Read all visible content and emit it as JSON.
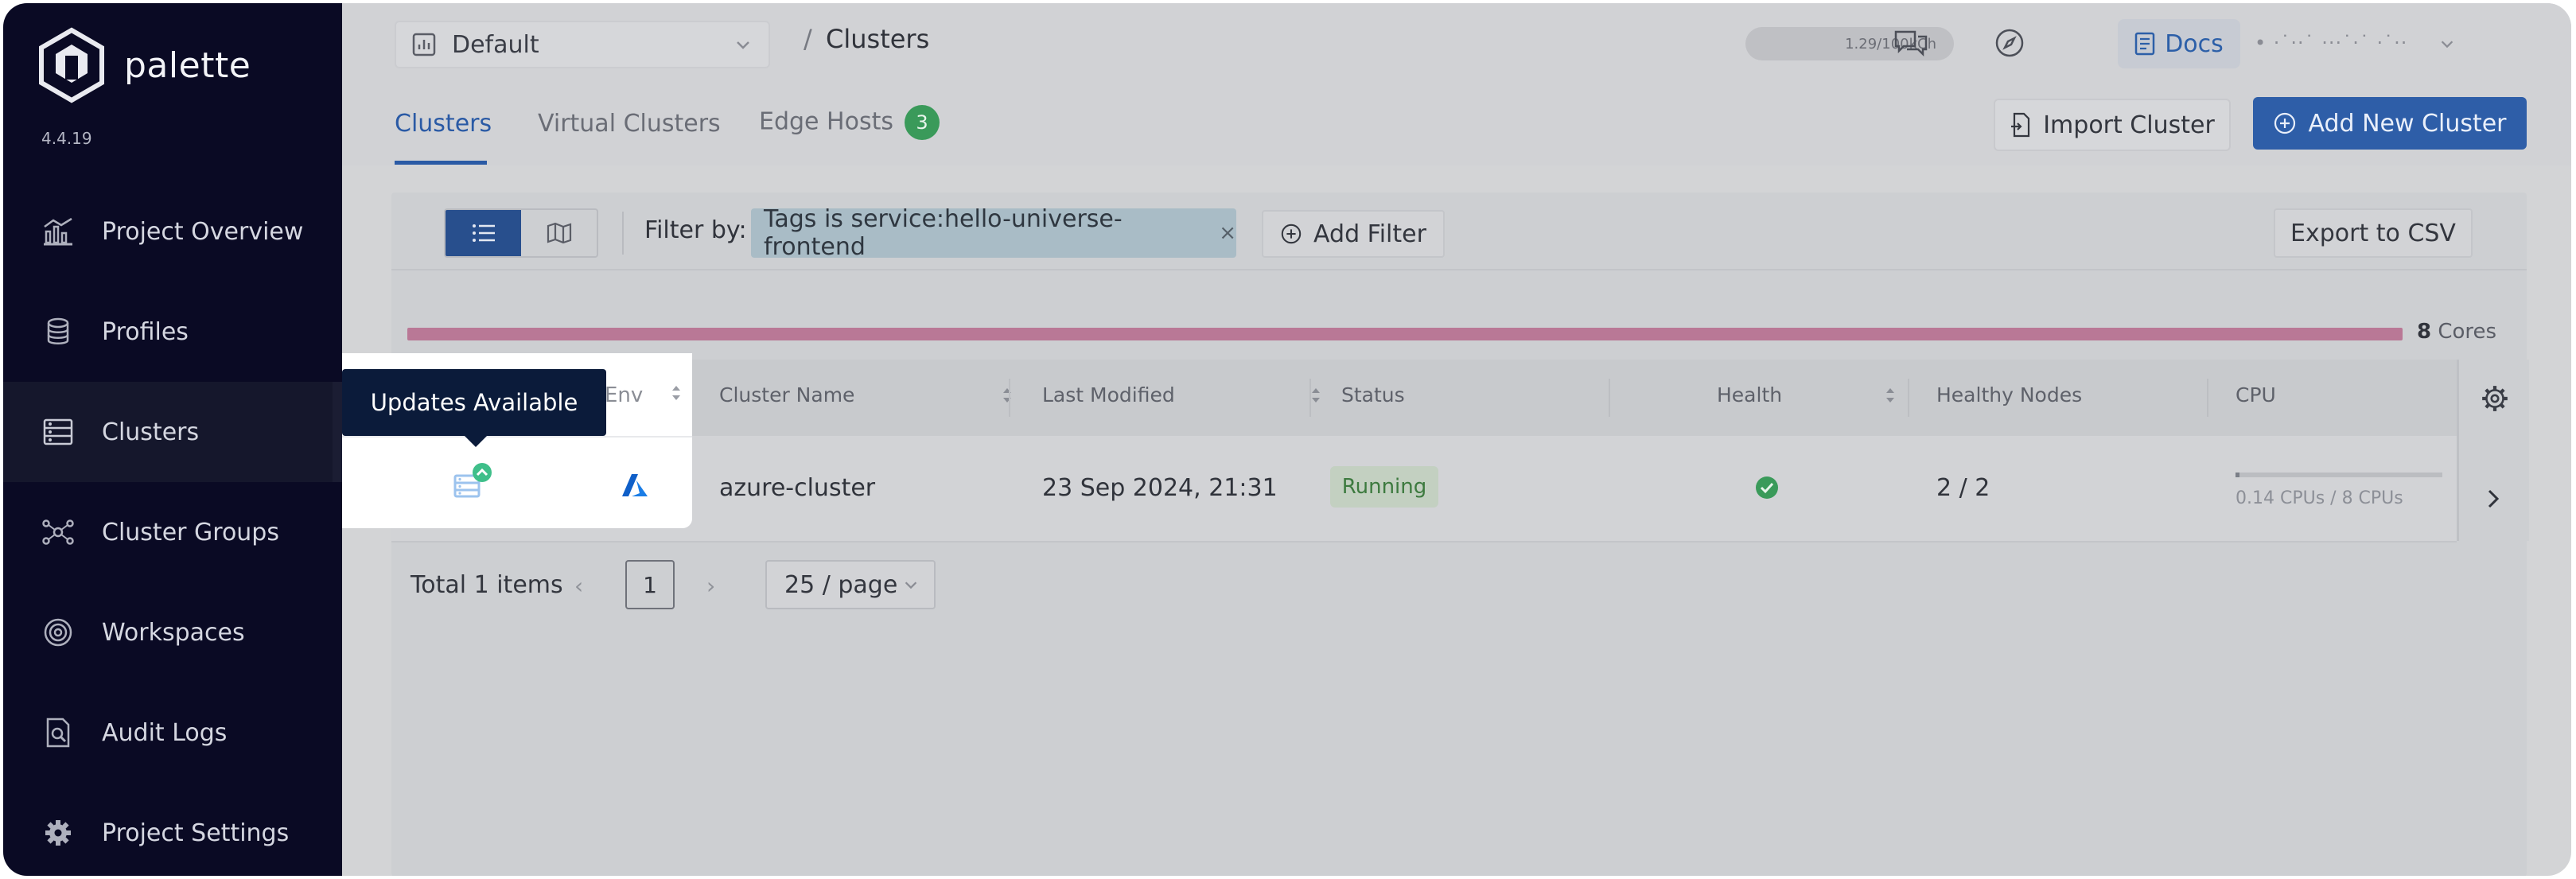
{
  "app": {
    "logo_text": "palette",
    "version": "4.4.19"
  },
  "sidebar": {
    "items": [
      {
        "label": "Project Overview",
        "icon": "chart-icon"
      },
      {
        "label": "Profiles",
        "icon": "database-icon"
      },
      {
        "label": "Clusters",
        "icon": "clusters-icon",
        "active": true
      },
      {
        "label": "Cluster Groups",
        "icon": "cluster-groups-icon"
      },
      {
        "label": "Workspaces",
        "icon": "workspaces-icon"
      },
      {
        "label": "Audit Logs",
        "icon": "audit-logs-icon"
      },
      {
        "label": "Project Settings",
        "icon": "gear-icon"
      }
    ]
  },
  "topbar": {
    "project": "Default",
    "breadcrumb_sep": "/",
    "breadcrumb": "Clusters",
    "usage": "1.29/100kCh",
    "docs_label": "Docs",
    "user": "• ·˙··˙ ···˙·˙ ·˙··"
  },
  "tabs": {
    "items": [
      "Clusters",
      "Virtual Clusters",
      "Edge Hosts"
    ],
    "edge_hosts_count": "3",
    "import_label": "Import Cluster",
    "add_label": "Add New Cluster"
  },
  "toolbar": {
    "filter_label": "Filter by:",
    "filter_chip": "Tags is service:hello-universe-frontend",
    "filter_chip_close": "×",
    "add_filter": "Add Filter",
    "export": "Export to CSV"
  },
  "usage_bar": {
    "cores_value": "8",
    "cores_unit": "Cores"
  },
  "table": {
    "columns": {
      "env": "Env",
      "name": "Cluster Name",
      "modified": "Last Modified",
      "status": "Status",
      "health": "Health",
      "nodes": "Healthy Nodes",
      "cpu": "CPU"
    },
    "rows": [
      {
        "name": "azure-cluster",
        "modified": "23 Sep 2024, 21:31",
        "status": "Running",
        "health": "healthy",
        "nodes": "2 / 2",
        "cpu_text": "0.14 CPUs / 8 CPUs",
        "cpu_fraction": 0.0175
      }
    ]
  },
  "pagination": {
    "total": "Total 1 items",
    "page": "1",
    "page_size": "25 / page"
  },
  "tooltip": {
    "text": "Updates Available"
  },
  "colors": {
    "sidebar_bg": "#0a0a24",
    "accent": "#2e5ea8",
    "status_green": "#3d7a3f",
    "core_bar": "#b97896",
    "badge": "#3a9a5a"
  }
}
